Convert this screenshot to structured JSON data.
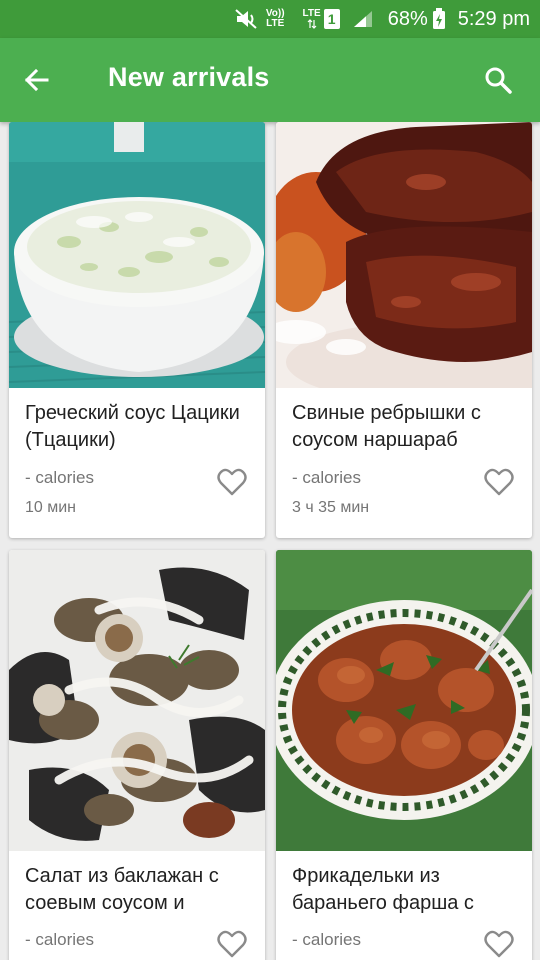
{
  "status_bar": {
    "volte_line1": "Vo))",
    "volte_line2": "LTE",
    "lte_label": "LTE",
    "sim_slot": "1",
    "battery_percent": "68%",
    "time": "5:29 pm"
  },
  "app_bar": {
    "title": "New arrivals",
    "back_icon": "arrow-back-icon",
    "search_icon": "search-icon"
  },
  "colors": {
    "status_bar": "#3f9b3a",
    "app_bar": "#4caf50",
    "background": "#ececec"
  },
  "recipes": [
    {
      "title": "Греческий соус Цацики (Тцацики)",
      "calories": "- calories",
      "time": "10 мин",
      "image": "tzatziki-sauce-photo"
    },
    {
      "title": "Свиные ребрышки с соусом наршараб",
      "calories": "- calories",
      "time": "3 ч 35 мин",
      "image": "pork-ribs-photo"
    },
    {
      "title": "Салат из баклажан с соевым соусом и",
      "calories": "- calories",
      "time": "",
      "image": "eggplant-salad-photo"
    },
    {
      "title": "Фрикадельки из бараньего фарша с",
      "calories": "- calories",
      "time": "",
      "image": "lamb-meatballs-photo"
    }
  ]
}
